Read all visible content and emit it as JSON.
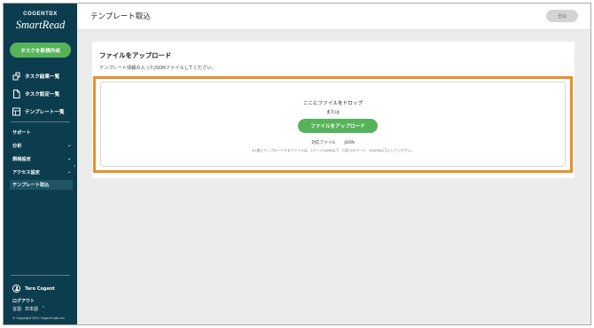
{
  "brand": {
    "company": "COGENTDX",
    "product": "SmartRead"
  },
  "sidebar": {
    "new_task_label": "タスクを新規作成",
    "nav": [
      {
        "label": "タスク結果一覧",
        "icon": "task-result-icon"
      },
      {
        "label": "タスク設定一覧",
        "icon": "document-icon"
      },
      {
        "label": "テンプレート一覧",
        "icon": "template-icon"
      }
    ],
    "menu": [
      {
        "label": "サポート",
        "chevron": ""
      },
      {
        "label": "分析",
        "chevron": "⌄"
      },
      {
        "label": "規格設定",
        "chevron": "⌄"
      },
      {
        "label": "アクセス設定",
        "chevron": "⌄"
      },
      {
        "label": "テンプレート取込",
        "chevron": ""
      }
    ],
    "collapse_glyph": "‹",
    "user_name": "Taro Cogent",
    "logout_label": "ログアウト",
    "language_label": "言語",
    "language_value": "日本語",
    "language_chevron": "⌃",
    "copyright": "© Copyright 2021 Cogent Labs Inc."
  },
  "header": {
    "title": "テンプレート取込",
    "register_label": "登録"
  },
  "card": {
    "title": "ファイルをアップロード",
    "description": "テンプレート情報の入ったJSONファイルしてください。",
    "drop_title": "ここにファイルをドロップ",
    "drop_or": "または",
    "upload_label": "ファイルをアップロード",
    "supported_label": "対応ファイル",
    "supported_value": "JSON",
    "note": "※1度にアップロードするファイルは、1ページ10MB以下、口計100ページ、200MB以下にしてください。"
  },
  "colors": {
    "sidebar_bg": "#0c3d4f",
    "accent_green": "#56b35a",
    "highlight_orange": "#e88f2b",
    "content_bg": "#ececec"
  }
}
